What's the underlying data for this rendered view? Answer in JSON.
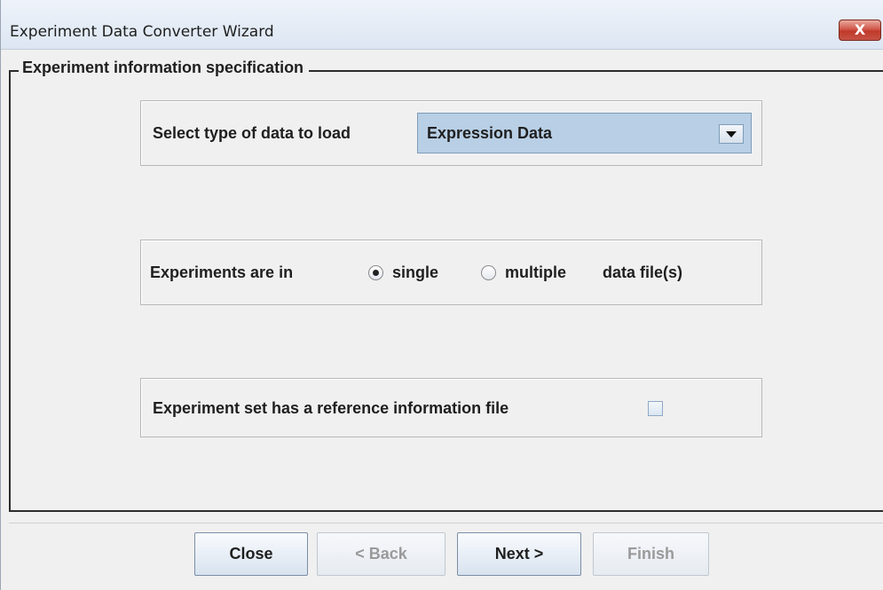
{
  "window": {
    "title": "Experiment Data Converter Wizard",
    "close_glyph": "X"
  },
  "group": {
    "title": "Experiment information specification"
  },
  "data_type": {
    "label": "Select type of data to load",
    "selected": "Expression Data"
  },
  "files": {
    "label": "Experiments are in",
    "options": [
      {
        "label": "single",
        "selected": true
      },
      {
        "label": "multiple",
        "selected": false
      }
    ],
    "suffix": "data file(s)"
  },
  "reference": {
    "label": "Experiment set has a reference information file",
    "checked": false
  },
  "buttons": {
    "close": "Close",
    "back": "< Back",
    "next": "Next >",
    "finish": "Finish"
  }
}
